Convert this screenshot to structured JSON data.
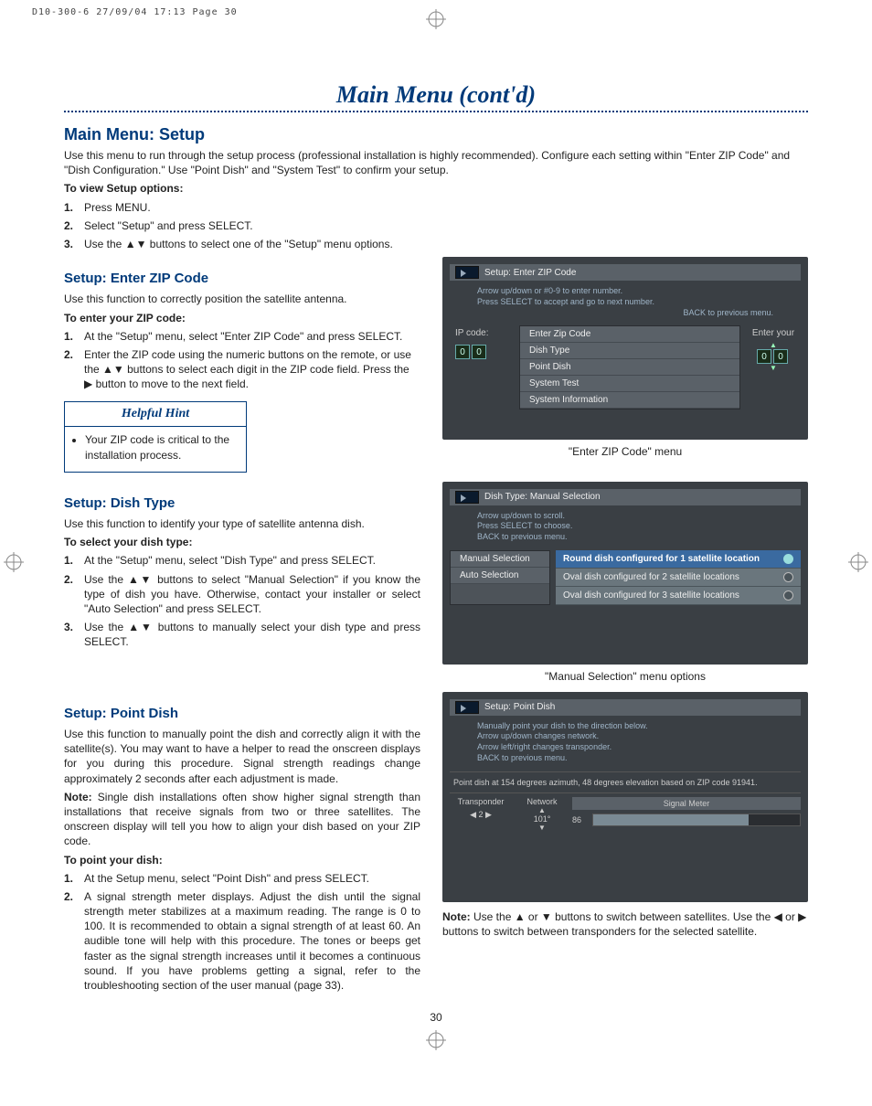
{
  "header_stamp": "D10-300-6  27/09/04  17:13  Page 30",
  "page_number": "30",
  "title": "Main Menu (cont'd)",
  "main": {
    "heading": "Main Menu: Setup",
    "intro": "Use this menu to run through the setup process (professional installation is highly recommended). Configure each setting within \"Enter ZIP Code\" and \"Dish Configuration.\" Use \"Point Dish\" and \"System Test\" to confirm your setup.",
    "view_label": "To view Setup options:",
    "steps": [
      "Press MENU.",
      "Select \"Setup\" and press SELECT.",
      "Use the ▲▼ buttons to select one of the \"Setup\" menu options."
    ]
  },
  "zip": {
    "heading": "Setup: Enter ZIP Code",
    "intro": "Use this function to correctly position the satellite antenna.",
    "label": "To enter your ZIP code:",
    "steps": [
      "At the \"Setup\" menu, select \"Enter ZIP Code\" and press SELECT.",
      "Enter the ZIP code using the numeric buttons on the remote, or use the ▲▼ buttons to select each digit in the ZIP code field. Press the ▶ button to move to the next field."
    ],
    "hint_title": "Helpful Hint",
    "hint_body": "Your ZIP code is critical to the installation process.",
    "screenshot": {
      "titlebar": "Setup: Enter ZIP Code",
      "lines": [
        "Arrow up/down or #0-9 to enter number.",
        "Press SELECT to accept and go to next number.",
        "BACK to previous menu."
      ],
      "left_label": "IP code:",
      "digits_left": [
        "0",
        "0"
      ],
      "menu": [
        "Enter Zip Code",
        "Dish Type",
        "Point Dish",
        "System Test",
        "System Information"
      ],
      "right_label": "Enter your",
      "digits_right": [
        "0",
        "0"
      ]
    },
    "caption": "\"Enter ZIP Code\" menu"
  },
  "dish": {
    "heading": "Setup: Dish Type",
    "intro": "Use this function to identify your type of satellite antenna dish.",
    "label": "To select your dish type:",
    "steps": [
      "At the \"Setup\" menu, select \"Dish Type\" and press SELECT.",
      "Use the ▲▼ buttons to select \"Manual Selection\" if you know the type of dish you have. Otherwise, contact your installer or select \"Auto Selection\" and press SELECT.",
      "Use the ▲▼ buttons to manually select your dish type and press SELECT."
    ],
    "screenshot": {
      "titlebar": "Dish Type: Manual Selection",
      "lines": [
        "Arrow up/down to scroll.",
        "Press SELECT to choose.",
        "BACK to previous menu."
      ],
      "left_menu": [
        "Manual Selection",
        "Auto Selection"
      ],
      "options": [
        {
          "label": "Round dish configured for 1 satellite location",
          "selected": true
        },
        {
          "label": "Oval dish configured for 2 satellite locations",
          "selected": false
        },
        {
          "label": "Oval dish configured for 3 satellite locations",
          "selected": false
        }
      ]
    },
    "caption": "\"Manual Selection\" menu options"
  },
  "point": {
    "heading": "Setup: Point Dish",
    "intro": "Use this function to manually point the dish and correctly align it with the satellite(s). You may want to have a helper to read the onscreen displays for you during this procedure. Signal strength readings change approximately 2 seconds after each adjustment is made.",
    "note_label": "Note:",
    "note_body": " Single dish installations often show higher signal strength than installations that receive signals from two or three satellites. The onscreen display will tell you how to align your dish based on your ZIP code.",
    "label": "To point your dish:",
    "steps": [
      "At the Setup menu, select \"Point Dish\" and press SELECT.",
      "A signal strength meter displays. Adjust the dish until the signal strength meter stabilizes at a maximum reading. The range is 0 to 100. It is recommended to obtain a signal strength of at least 60. An audible tone will help with this procedure. The tones or beeps get faster as the signal strength increases until it becomes a continuous sound. If you have problems getting a signal, refer to the troubleshooting section of the user manual (page 33)."
    ],
    "screenshot": {
      "titlebar": "Setup: Point Dish",
      "lines": [
        "Manually point your dish to the direction below.",
        "Arrow up/down changes network.",
        "Arrow left/right changes transponder.",
        "BACK to previous menu."
      ],
      "pointinfo": "Point dish at 154 degrees azimuth, 48 degrees elevation based on ZIP code 91941.",
      "col_transponder": "Transponder",
      "col_network": "Network",
      "col_meter": "Signal Meter",
      "transponder_val": "2",
      "network_val": "101°",
      "meter_val": "86"
    },
    "below_note_label": "Note:",
    "below_note": " Use the ▲ or ▼ buttons to switch between satellites. Use the ◀ or ▶ buttons to switch between transponders for the selected satellite."
  }
}
